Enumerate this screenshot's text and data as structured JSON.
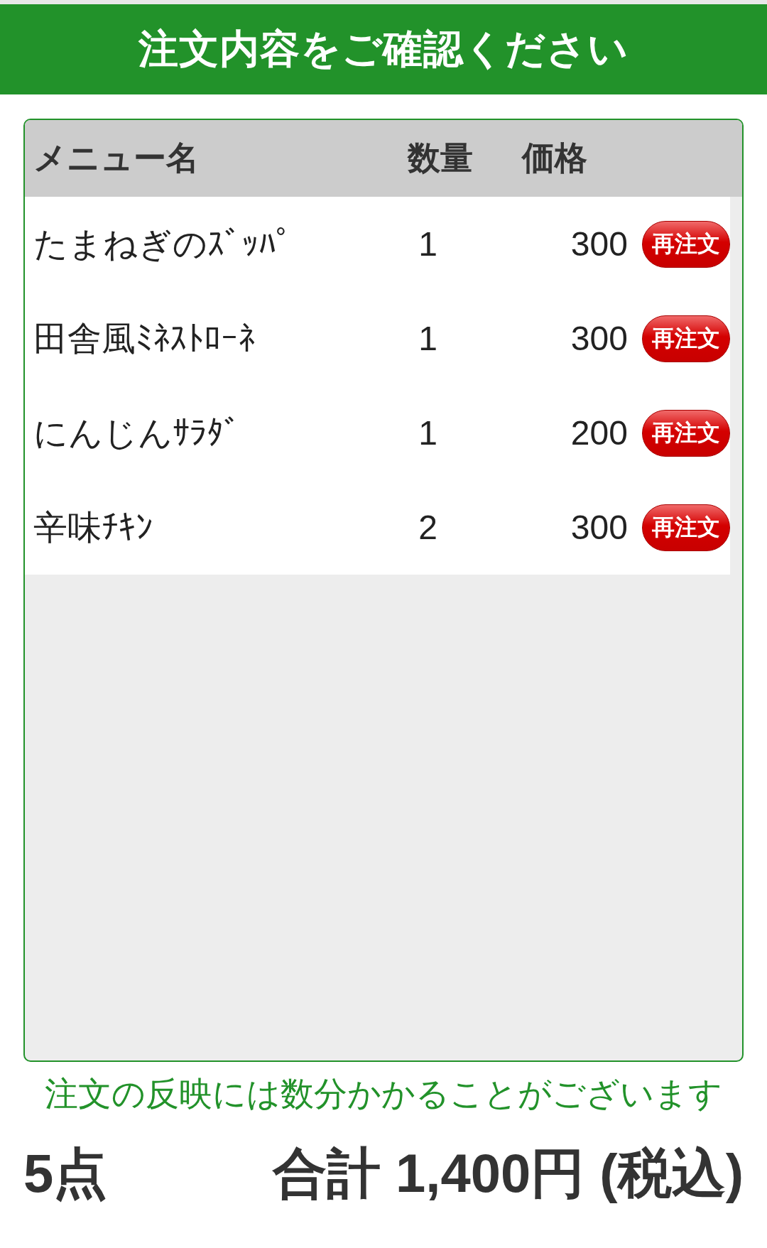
{
  "header": {
    "title": "注文内容をご確認ください"
  },
  "table": {
    "columns": [
      "メニュー名",
      "数量",
      "価格"
    ],
    "rows": [
      {
        "name": "たまねぎのｽﾞｯﾊﾟ",
        "quantity": "1",
        "price": "300",
        "action": "再注文"
      },
      {
        "name": "田舎風ﾐﾈｽﾄﾛｰﾈ",
        "quantity": "1",
        "price": "300",
        "action": "再注文"
      },
      {
        "name": "にんじんｻﾗﾀﾞ",
        "quantity": "1",
        "price": "200",
        "action": "再注文"
      },
      {
        "name": "辛味ﾁｷﾝ",
        "quantity": "2",
        "price": "300",
        "action": "再注文"
      }
    ]
  },
  "note": "注文の反映には数分かかることがございます",
  "footer": {
    "count": "5点",
    "total": "合計 1,400円 (税込)"
  }
}
